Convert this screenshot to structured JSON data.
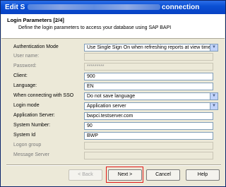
{
  "window": {
    "title_left": "Edit S",
    "title_right": "connection"
  },
  "header": {
    "title": "Login Parameters [2/4]",
    "subtitle": "Define the login parameters to access your database using SAP BAPI"
  },
  "form": {
    "rows": [
      {
        "label": "Authentication Mode",
        "value": "Use Single Sign On when refreshing reports at view time",
        "type": "select",
        "enabled": true
      },
      {
        "label": "User name:",
        "value": "",
        "type": "text",
        "enabled": false
      },
      {
        "label": "Password:",
        "value": "*********",
        "type": "text",
        "enabled": false
      },
      {
        "label": "Client:",
        "value": "900",
        "type": "text",
        "enabled": true
      },
      {
        "label": "Language:",
        "value": "EN",
        "type": "text",
        "enabled": true
      },
      {
        "label": "When connecting with SSO",
        "value": "Do not save language",
        "type": "select",
        "enabled": true
      },
      {
        "label": "Login mode",
        "value": "Application server",
        "type": "select",
        "enabled": true
      },
      {
        "label": "Application Server:",
        "value": "bwpci.testserver.com",
        "type": "text",
        "enabled": true
      },
      {
        "label": "System Number:",
        "value": "90",
        "type": "text",
        "enabled": true
      },
      {
        "label": "System Id",
        "value": "BWP",
        "type": "text",
        "enabled": true
      },
      {
        "label": "Logon group",
        "value": "",
        "type": "text",
        "enabled": false
      },
      {
        "label": "Message Server",
        "value": "",
        "type": "text",
        "enabled": false
      }
    ]
  },
  "buttons": {
    "back_label": "< Back",
    "next_label": "Next >",
    "cancel_label": "Cancel",
    "help_label": "Help"
  },
  "colors": {
    "titlebar": "#0a4fd4",
    "highlight": "#e01818"
  }
}
